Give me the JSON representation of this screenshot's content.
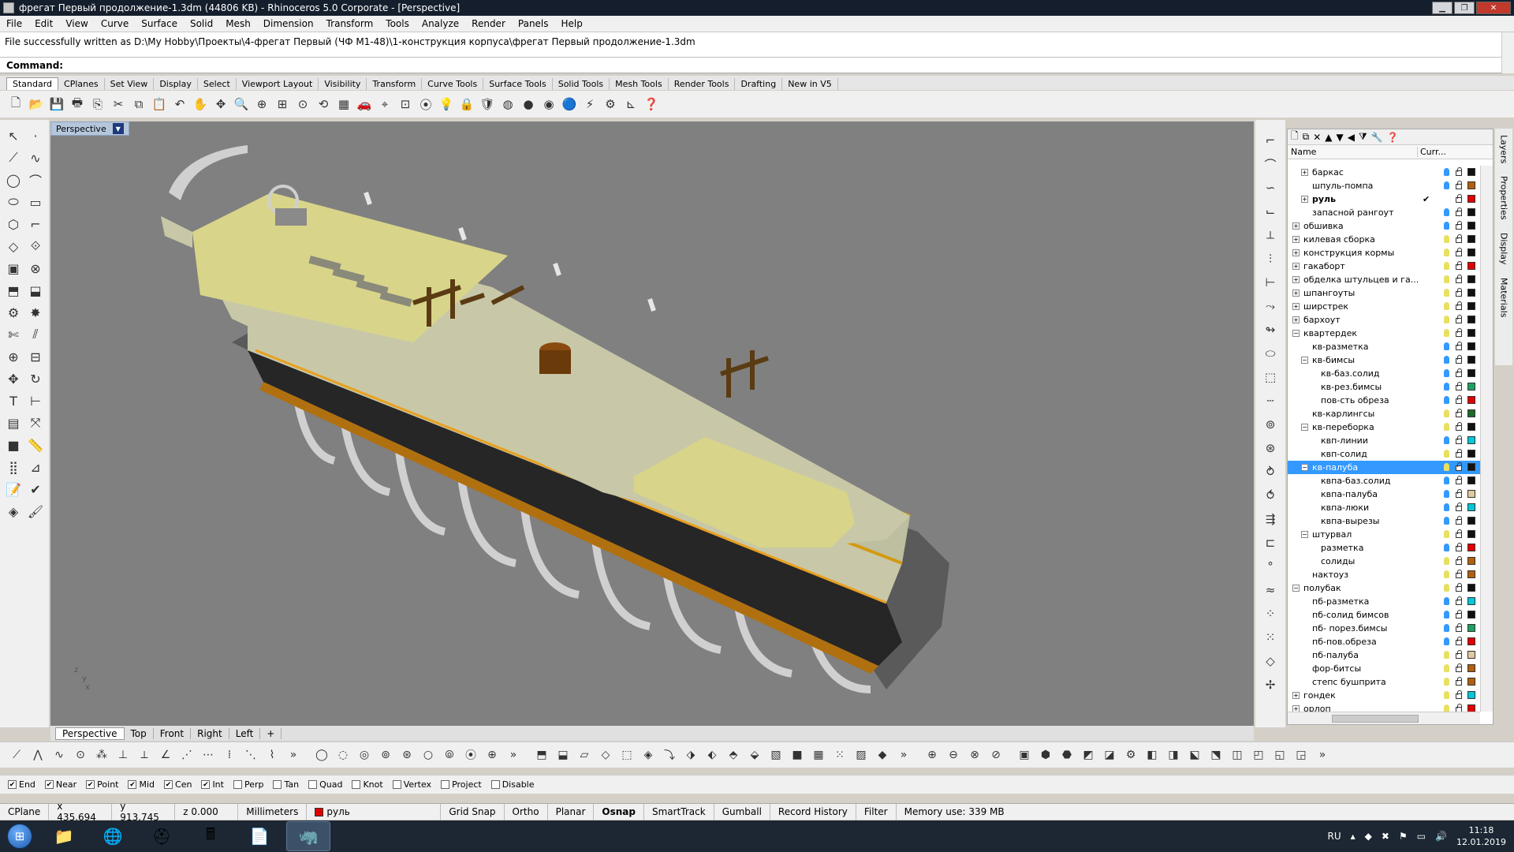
{
  "window": {
    "title": "фрегат Первый продолжение-1.3dm (44806 KB) - Rhinoceros  5.0 Corporate - [Perspective]"
  },
  "menu": [
    "File",
    "Edit",
    "View",
    "Curve",
    "Surface",
    "Solid",
    "Mesh",
    "Dimension",
    "Transform",
    "Tools",
    "Analyze",
    "Render",
    "Panels",
    "Help"
  ],
  "command": {
    "history": "File successfully written as D:\\My Hobby\\Проекты\\4-фрегат Первый (ЧФ М1-48)\\1-конструкция корпуса\\фрегат Первый продолжение-1.3dm",
    "prompt": "Command:"
  },
  "toolbar_tabs": [
    "Standard",
    "CPlanes",
    "Set View",
    "Display",
    "Select",
    "Viewport Layout",
    "Visibility",
    "Transform",
    "Curve Tools",
    "Surface Tools",
    "Solid Tools",
    "Mesh Tools",
    "Render Tools",
    "Drafting",
    "New in V5"
  ],
  "viewport": {
    "label": "Perspective",
    "axis_labels": {
      "z": "z",
      "y": "y",
      "x": "x"
    },
    "colors": {
      "background": "#808080",
      "deck": "#dcd98f",
      "hull_black": "#2c2c2c",
      "frames": "#e4e4e4",
      "wood": "#5a3b12",
      "trim": "#d4a017"
    }
  },
  "viewport_tabs": [
    "Perspective",
    "Top",
    "Front",
    "Right",
    "Left",
    "+"
  ],
  "layers": {
    "columns": {
      "name": "Name",
      "current": "Curr..."
    },
    "rows": [
      {
        "name": "баркас",
        "indent": 1,
        "tw": "+",
        "color": "#111111",
        "bulb": "#3399ff"
      },
      {
        "name": "шпуль-помпа",
        "indent": 1,
        "tw": "",
        "color": "#b06010",
        "bulb": "#3399ff"
      },
      {
        "name": "руль",
        "indent": 1,
        "tw": "+",
        "color": "#e00000",
        "bulb": "",
        "bold": true,
        "current": true
      },
      {
        "name": "запасной рангоут",
        "indent": 1,
        "tw": "",
        "color": "#111111",
        "bulb": "#3399ff"
      },
      {
        "name": "обшивка",
        "indent": 0,
        "tw": "+",
        "color": "#111111",
        "bulb": "#3399ff"
      },
      {
        "name": "килевая сборка",
        "indent": 0,
        "tw": "+",
        "color": "#111111",
        "bulb": "#e8e060"
      },
      {
        "name": "конструкция кормы",
        "indent": 0,
        "tw": "+",
        "color": "#111111",
        "bulb": "#e8e060"
      },
      {
        "name": "гакаборт",
        "indent": 0,
        "tw": "+",
        "color": "#e00000",
        "bulb": "#e8e060"
      },
      {
        "name": "обделка штульцев и га...",
        "indent": 0,
        "tw": "+",
        "color": "#111111",
        "bulb": "#e8e060"
      },
      {
        "name": "шпангоуты",
        "indent": 0,
        "tw": "+",
        "color": "#111111",
        "bulb": "#e8e060"
      },
      {
        "name": "ширстрек",
        "indent": 0,
        "tw": "+",
        "color": "#111111",
        "bulb": "#e8e060"
      },
      {
        "name": "бархоут",
        "indent": 0,
        "tw": "+",
        "color": "#111111",
        "bulb": "#e8e060"
      },
      {
        "name": "квартердек",
        "indent": 0,
        "tw": "−",
        "color": "#111111",
        "bulb": "#e8e060"
      },
      {
        "name": "кв-разметка",
        "indent": 1,
        "tw": "",
        "color": "#111111",
        "bulb": "#3399ff"
      },
      {
        "name": "кв-бимсы",
        "indent": 1,
        "tw": "−",
        "color": "#111111",
        "bulb": "#3399ff"
      },
      {
        "name": "кв-баз.солид",
        "indent": 2,
        "tw": "",
        "color": "#111111",
        "bulb": "#3399ff"
      },
      {
        "name": "кв-рез.бимсы",
        "indent": 2,
        "tw": "",
        "color": "#20a060",
        "bulb": "#3399ff"
      },
      {
        "name": "пов-сть обреза",
        "indent": 2,
        "tw": "",
        "color": "#e00000",
        "bulb": "#3399ff"
      },
      {
        "name": "кв-карлингсы",
        "indent": 1,
        "tw": "",
        "color": "#1a6a2a",
        "bulb": "#e8e060"
      },
      {
        "name": "кв-переборка",
        "indent": 1,
        "tw": "−",
        "color": "#111111",
        "bulb": "#e8e060"
      },
      {
        "name": "квп-линии",
        "indent": 2,
        "tw": "",
        "color": "#00c8d8",
        "bulb": "#3399ff"
      },
      {
        "name": "квп-солид",
        "indent": 2,
        "tw": "",
        "color": "#111111",
        "bulb": "#e8e060"
      },
      {
        "name": "кв-палуба",
        "indent": 1,
        "tw": "−",
        "color": "#111111",
        "bulb": "#e8e060",
        "selected": true
      },
      {
        "name": "квпа-баз.солид",
        "indent": 2,
        "tw": "",
        "color": "#111111",
        "bulb": "#3399ff"
      },
      {
        "name": "квпа-палуба",
        "indent": 2,
        "tw": "",
        "color": "#e0c8a0",
        "bulb": "#3399ff"
      },
      {
        "name": "квпа-люки",
        "indent": 2,
        "tw": "",
        "color": "#00c8d8",
        "bulb": "#3399ff"
      },
      {
        "name": "квпа-вырезы",
        "indent": 2,
        "tw": "",
        "color": "#111111",
        "bulb": "#3399ff"
      },
      {
        "name": "штурвал",
        "indent": 1,
        "tw": "−",
        "color": "#111111",
        "bulb": "#e8e060"
      },
      {
        "name": "разметка",
        "indent": 2,
        "tw": "",
        "color": "#e00000",
        "bulb": "#3399ff"
      },
      {
        "name": "солиды",
        "indent": 2,
        "tw": "",
        "color": "#b06010",
        "bulb": "#e8e060"
      },
      {
        "name": "нактоуз",
        "indent": 1,
        "tw": "",
        "color": "#b06010",
        "bulb": "#e8e060"
      },
      {
        "name": "полубак",
        "indent": 0,
        "tw": "−",
        "color": "#111111",
        "bulb": "#e8e060"
      },
      {
        "name": "пб-разметка",
        "indent": 1,
        "tw": "",
        "color": "#00c8d8",
        "bulb": "#3399ff"
      },
      {
        "name": "пб-солид бимсов",
        "indent": 1,
        "tw": "",
        "color": "#111111",
        "bulb": "#3399ff"
      },
      {
        "name": "пб- порез.бимсы",
        "indent": 1,
        "tw": "",
        "color": "#20a060",
        "bulb": "#3399ff"
      },
      {
        "name": "пб-пов.обреза",
        "indent": 1,
        "tw": "",
        "color": "#e00000",
        "bulb": "#3399ff"
      },
      {
        "name": "пб-палуба",
        "indent": 1,
        "tw": "",
        "color": "#e0c8a0",
        "bulb": "#e8e060"
      },
      {
        "name": "фор-битсы",
        "indent": 1,
        "tw": "",
        "color": "#b06010",
        "bulb": "#e8e060"
      },
      {
        "name": "степс бушприта",
        "indent": 1,
        "tw": "",
        "color": "#b06010",
        "bulb": "#e8e060"
      },
      {
        "name": "гондек",
        "indent": 0,
        "tw": "+",
        "color": "#00c8d8",
        "bulb": "#e8e060"
      },
      {
        "name": "орлоп",
        "indent": 0,
        "tw": "+",
        "color": "#e00000",
        "bulb": "#e8e060"
      }
    ]
  },
  "side_tabs": [
    "Layers",
    "Properties",
    "Display",
    "Materials"
  ],
  "osnap": [
    {
      "label": "End",
      "checked": true
    },
    {
      "label": "Near",
      "checked": true
    },
    {
      "label": "Point",
      "checked": true
    },
    {
      "label": "Mid",
      "checked": true
    },
    {
      "label": "Cen",
      "checked": true
    },
    {
      "label": "Int",
      "checked": true
    },
    {
      "label": "Perp",
      "checked": false
    },
    {
      "label": "Tan",
      "checked": false
    },
    {
      "label": "Quad",
      "checked": false
    },
    {
      "label": "Knot",
      "checked": false
    },
    {
      "label": "Vertex",
      "checked": false
    },
    {
      "label": "Project",
      "checked": false
    },
    {
      "label": "Disable",
      "checked": false
    }
  ],
  "status": {
    "cplane": "CPlane",
    "x": "x 435.694",
    "y": "y 913.745",
    "z": "z 0.000",
    "units": "Millimeters",
    "layer": "руль",
    "grid_snap": "Grid Snap",
    "ortho": "Ortho",
    "planar": "Planar",
    "osnap": "Osnap",
    "smarttrack": "SmartTrack",
    "gumball": "Gumball",
    "record_history": "Record History",
    "filter": "Filter",
    "memory": "Memory use: 339 MB"
  },
  "taskbar": {
    "lang": "RU",
    "time": "11:18",
    "date": "12.01.2019"
  }
}
